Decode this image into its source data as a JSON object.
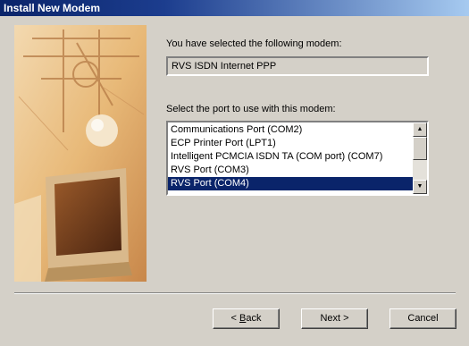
{
  "window": {
    "title": "Install New Modem"
  },
  "main": {
    "selected_label": "You have selected the following modem:",
    "modem_name": "RVS ISDN Internet PPP",
    "port_label": "Select the port to use with this modem:",
    "ports": [
      {
        "label": "Communications Port (COM2)",
        "selected": false
      },
      {
        "label": "ECP Printer Port (LPT1)",
        "selected": false
      },
      {
        "label": "Intelligent PCMCIA ISDN TA (COM port) (COM7)",
        "selected": false
      },
      {
        "label": "RVS Port (COM3)",
        "selected": false
      },
      {
        "label": "RVS Port (COM4)",
        "selected": true
      }
    ]
  },
  "buttons": {
    "back_mnemonic": "B",
    "back_rest": "ack",
    "back_prefix": "< ",
    "next_label": "Next >",
    "cancel_label": "Cancel"
  },
  "colors": {
    "title_bar": "#0a246a",
    "selection": "#0a246a",
    "dialog_face": "#d4d0c8",
    "wizard_image_tone": "#e8b978"
  },
  "icons": {
    "scroll_up": "scroll-up-arrow-icon",
    "scroll_down": "scroll-down-arrow-icon",
    "wizard_image": "computer-monitor-illustration"
  }
}
